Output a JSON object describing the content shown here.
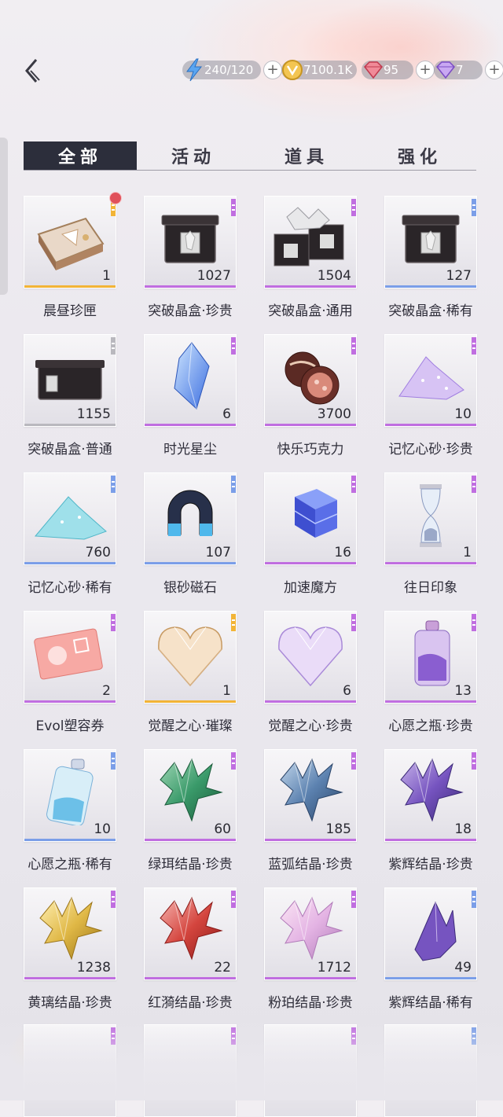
{
  "colors": {
    "accent_dark": "#2c2e3b",
    "rarity_purple": "#c06ee0",
    "rarity_blue": "#7b9ee8",
    "rarity_gold": "#f2b437",
    "notification_red": "#e0505a"
  },
  "header": {
    "back_icon": "back-chevron-icon",
    "resources": [
      {
        "icon": "stamina-lightning-icon",
        "value": "240/120",
        "has_plus": true
      },
      {
        "icon": "gold-coin-icon",
        "value": "7100.1K",
        "has_plus": false
      },
      {
        "icon": "red-diamond-icon",
        "value": "95",
        "has_plus": true
      },
      {
        "icon": "purple-diamond-icon",
        "value": "7",
        "has_plus": true
      }
    ]
  },
  "tabs": [
    {
      "label": "全部",
      "active": true
    },
    {
      "label": "活动",
      "active": false
    },
    {
      "label": "道具",
      "active": false
    },
    {
      "label": "强化",
      "active": false
    }
  ],
  "items": [
    {
      "name": "晨昼珍匣",
      "count": "1",
      "rarity": "gold",
      "icon": "gift-box-icon",
      "badge": true
    },
    {
      "name": "突破晶盒·珍贵",
      "count": "1027",
      "rarity": "purple",
      "icon": "crystal-box-icon"
    },
    {
      "name": "突破晶盒·通用",
      "count": "1504",
      "rarity": "purple",
      "icon": "crystal-box-multi-icon"
    },
    {
      "name": "突破晶盒·稀有",
      "count": "127",
      "rarity": "blue",
      "icon": "crystal-box-icon"
    },
    {
      "name": "突破晶盒·普通",
      "count": "1155",
      "rarity": "gray",
      "icon": "crystal-box-flat-icon"
    },
    {
      "name": "时光星尘",
      "count": "6",
      "rarity": "purple",
      "icon": "blue-crystal-icon"
    },
    {
      "name": "快乐巧克力",
      "count": "3700",
      "rarity": "purple",
      "icon": "chocolate-icon"
    },
    {
      "name": "记忆心砂·珍贵",
      "count": "10",
      "rarity": "purple",
      "icon": "purple-sand-icon"
    },
    {
      "name": "记忆心砂·稀有",
      "count": "760",
      "rarity": "blue",
      "icon": "blue-sand-icon"
    },
    {
      "name": "银砂磁石",
      "count": "107",
      "rarity": "blue",
      "icon": "magnet-icon"
    },
    {
      "name": "加速魔方",
      "count": "16",
      "rarity": "purple",
      "icon": "cube-icon"
    },
    {
      "name": "往日印象",
      "count": "1",
      "rarity": "purple",
      "icon": "hourglass-icon"
    },
    {
      "name": "Evol塑容券",
      "count": "2",
      "rarity": "purple",
      "icon": "ticket-icon"
    },
    {
      "name": "觉醒之心·璀璨",
      "count": "1",
      "rarity": "gold",
      "icon": "diamond-heart-gold-icon"
    },
    {
      "name": "觉醒之心·珍贵",
      "count": "6",
      "rarity": "purple",
      "icon": "diamond-heart-icon"
    },
    {
      "name": "心愿之瓶·珍贵",
      "count": "13",
      "rarity": "purple",
      "icon": "purple-bottle-icon"
    },
    {
      "name": "心愿之瓶·稀有",
      "count": "10",
      "rarity": "blue",
      "icon": "blue-bottle-icon"
    },
    {
      "name": "绿珥结晶·珍贵",
      "count": "60",
      "rarity": "purple",
      "icon": "green-crystal-icon"
    },
    {
      "name": "蓝弧结晶·珍贵",
      "count": "185",
      "rarity": "purple",
      "icon": "blue-crystal-cluster-icon"
    },
    {
      "name": "紫辉结晶·珍贵",
      "count": "18",
      "rarity": "purple",
      "icon": "purple-crystal-cluster-icon"
    },
    {
      "name": "黄璃结晶·珍贵",
      "count": "1238",
      "rarity": "purple",
      "icon": "yellow-crystal-icon"
    },
    {
      "name": "红漪结晶·珍贵",
      "count": "22",
      "rarity": "purple",
      "icon": "red-crystal-icon"
    },
    {
      "name": "粉珀结晶·珍贵",
      "count": "1712",
      "rarity": "purple",
      "icon": "pink-crystal-icon"
    },
    {
      "name": "紫辉结晶·稀有",
      "count": "49",
      "rarity": "blue",
      "icon": "small-purple-crystal-icon"
    }
  ]
}
